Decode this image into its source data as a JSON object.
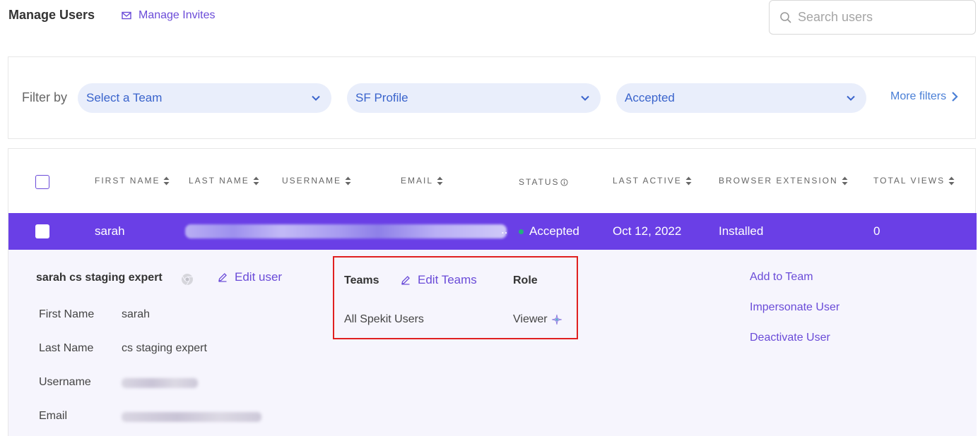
{
  "header": {
    "title": "Manage Users",
    "invites_label": "Manage Invites",
    "search_placeholder": "Search users"
  },
  "filters": {
    "label": "Filter by",
    "team_select": "Select a Team",
    "profile_select": "SF Profile",
    "status_select": "Accepted",
    "more_label": "More filters"
  },
  "table": {
    "columns": {
      "first_name": "FIRST NAME",
      "last_name": "LAST NAME",
      "username": "USERNAME",
      "email": "EMAIL",
      "status": "STATUS",
      "last_active": "LAST ACTIVE",
      "browser_extension": "BROWSER EXTENSION",
      "total_views": "TOTAL VIEWS"
    },
    "row": {
      "first_name": "sarah",
      "ellipsis": "..",
      "status": "Accepted",
      "last_active": "Oct 12, 2022",
      "browser_extension": "Installed",
      "total_views": "0"
    }
  },
  "details": {
    "full_name": "sarah cs staging expert",
    "edit_user_label": "Edit user",
    "fields": {
      "first_name_label": "First Name",
      "first_name_value": "sarah",
      "last_name_label": "Last Name",
      "last_name_value": "cs staging expert",
      "username_label": "Username",
      "email_label": "Email"
    },
    "teams": {
      "title": "Teams",
      "edit_label": "Edit Teams",
      "role_title": "Role",
      "team_name": "All Spekit Users",
      "role_value": "Viewer"
    },
    "actions": {
      "add_to_team": "Add to Team",
      "impersonate": "Impersonate User",
      "deactivate": "Deactivate User"
    }
  },
  "colors": {
    "accent": "#6a3fe6",
    "link": "#6a4bd8",
    "filter_bg": "#e9eefb",
    "status_green": "#22b07d",
    "highlight_red": "#e02020"
  }
}
